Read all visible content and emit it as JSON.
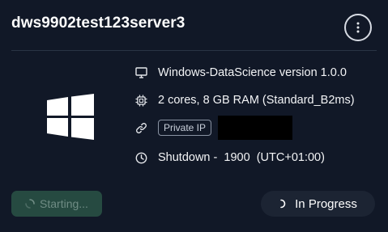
{
  "header": {
    "title": "dws9902test123server3",
    "menu_icon": "more-vertical-icon"
  },
  "os": {
    "logo_icon": "windows-logo-icon"
  },
  "info": {
    "image": {
      "icon": "monitor-icon",
      "text": "Windows-DataScience version 1.0.0"
    },
    "size": {
      "icon": "cpu-chip-icon",
      "text": "2 cores, 8 GB RAM (Standard_B2ms)"
    },
    "ip": {
      "icon": "link-icon",
      "badge": "Private IP"
    },
    "shutdown": {
      "icon": "clock-icon",
      "text": "Shutdown -  1900  (UTC+01:00)"
    }
  },
  "actions": {
    "start_label": "Starting...",
    "status_label": "In Progress"
  },
  "colors": {
    "background": "#111827",
    "start_button": "#2e5b4a",
    "status_pill": "#1c2433"
  }
}
